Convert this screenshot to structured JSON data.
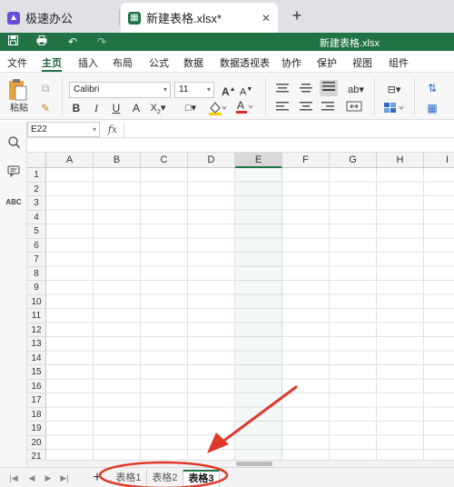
{
  "browser_tabs": [
    {
      "label": "极速办公",
      "active": false
    },
    {
      "label": "新建表格.xlsx*",
      "active": true
    }
  ],
  "title_bar": {
    "document_title": "新建表格.xlsx"
  },
  "menu": {
    "items": [
      "文件",
      "主页",
      "插入",
      "布局",
      "公式",
      "数据",
      "数据透视表",
      "协作",
      "保护",
      "视图",
      "组件"
    ],
    "active": "主页"
  },
  "ribbon": {
    "paste_label": "粘贴",
    "font_name": "Calibri",
    "font_size": "11",
    "bold": "B",
    "italic": "I",
    "underline": "U",
    "grow_font": "A",
    "shrink_font": "A"
  },
  "formula_bar": {
    "name_box": "E22",
    "fx": "fx",
    "value": ""
  },
  "grid": {
    "columns": [
      "A",
      "B",
      "C",
      "D",
      "E",
      "F",
      "G",
      "H",
      "I"
    ],
    "rows": [
      "1",
      "2",
      "3",
      "4",
      "5",
      "6",
      "7",
      "8",
      "9",
      "10",
      "11",
      "12",
      "13",
      "14",
      "15",
      "16",
      "17",
      "18",
      "19",
      "20",
      "21"
    ],
    "selected_column": "E"
  },
  "sheets": {
    "tabs": [
      "表格1",
      "表格2",
      "表格3"
    ],
    "active": "表格3"
  },
  "colors": {
    "accent": "#217346",
    "annotation": "#e0382b"
  }
}
